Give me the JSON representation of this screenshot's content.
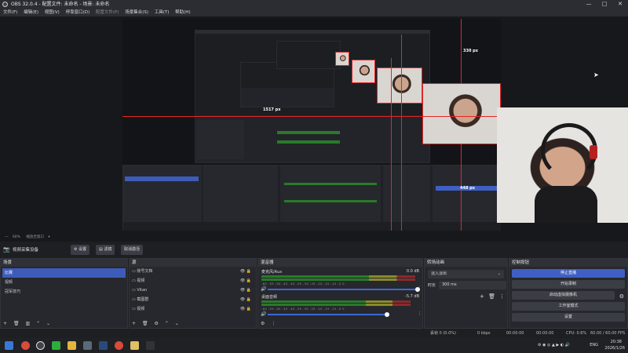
{
  "window": {
    "title": "OBS 32.0.4 - 配置文件: 未命名 - 场景: 未命名",
    "buttons": [
      "—",
      "□",
      "✕"
    ]
  },
  "menu": [
    {
      "label": "文件(F)",
      "dim": false
    },
    {
      "label": "编辑(E)",
      "dim": false
    },
    {
      "label": "视图(V)",
      "dim": false
    },
    {
      "label": "停靠窗口(D)",
      "dim": false
    },
    {
      "label": "配置文件(P)",
      "dim": true
    },
    {
      "label": "场景集合(S)",
      "dim": false
    },
    {
      "label": "工具(T)",
      "dim": false
    },
    {
      "label": "帮助(H)",
      "dim": false
    }
  ],
  "preview": {
    "measure_width": "1517 px",
    "measure_height": "330 px",
    "measure_small": "448 px",
    "zoom": "60%",
    "zoom_label": "缩放至窗口"
  },
  "source_toolbar": {
    "source_name": "视频采集设备",
    "properties": "设置",
    "filters": "滤镜",
    "deactivate": "取消激活"
  },
  "scenes": {
    "header": "场景",
    "items": [
      {
        "label": "比赛",
        "selected": true
      },
      {
        "label": "视频",
        "selected": false
      },
      {
        "label": "冠军技巧",
        "selected": false
      }
    ]
  },
  "sources": {
    "header": "源",
    "items": [
      {
        "label": "账号文档"
      },
      {
        "label": "视频"
      },
      {
        "label": "Vitan"
      },
      {
        "label": "截图群"
      },
      {
        "label": "视频"
      }
    ]
  },
  "mixer": {
    "header": "混音器",
    "channels": [
      {
        "name": "麦克风/Aux",
        "db": "0.0 dB",
        "level": 0.92,
        "volume": 0.98
      },
      {
        "name": "桌面音频",
        "db": "-5.7 dB",
        "level": 0.86,
        "volume": 0.78
      }
    ],
    "ticks": [
      "-60",
      "-55",
      "-50",
      "-45",
      "-40",
      "-35",
      "-30",
      "-25",
      "-20",
      "-15",
      "-10",
      "-5",
      "0"
    ]
  },
  "transitions": {
    "header": "转场动画",
    "selected": "淡入淡出",
    "duration_label": "时长",
    "duration": "300 ms"
  },
  "controls": {
    "header": "控制按钮",
    "buttons": [
      {
        "label": "停止直播",
        "active": true
      },
      {
        "label": "开始录制",
        "active": false
      },
      {
        "label": "启动虚拟摄像机",
        "active": false
      },
      {
        "label": "工作室模式",
        "active": false
      },
      {
        "label": "设置",
        "active": false
      }
    ]
  },
  "status": {
    "dropped": "丢帧 0 (0.0%)",
    "bitrate": "0 kbps",
    "stream_time": "00:00:00",
    "rec_time": "00:00:00",
    "cpu": "CPU: 0.6%",
    "fps": "60.00 / 60.00 FPS"
  },
  "taskbar": {
    "lang": "ENG",
    "time": "20:38",
    "date": "2026/1/26"
  },
  "colors": {
    "accent": "#3f5fc4",
    "selection": "#3d5cba",
    "red_guides": "#e32626"
  }
}
